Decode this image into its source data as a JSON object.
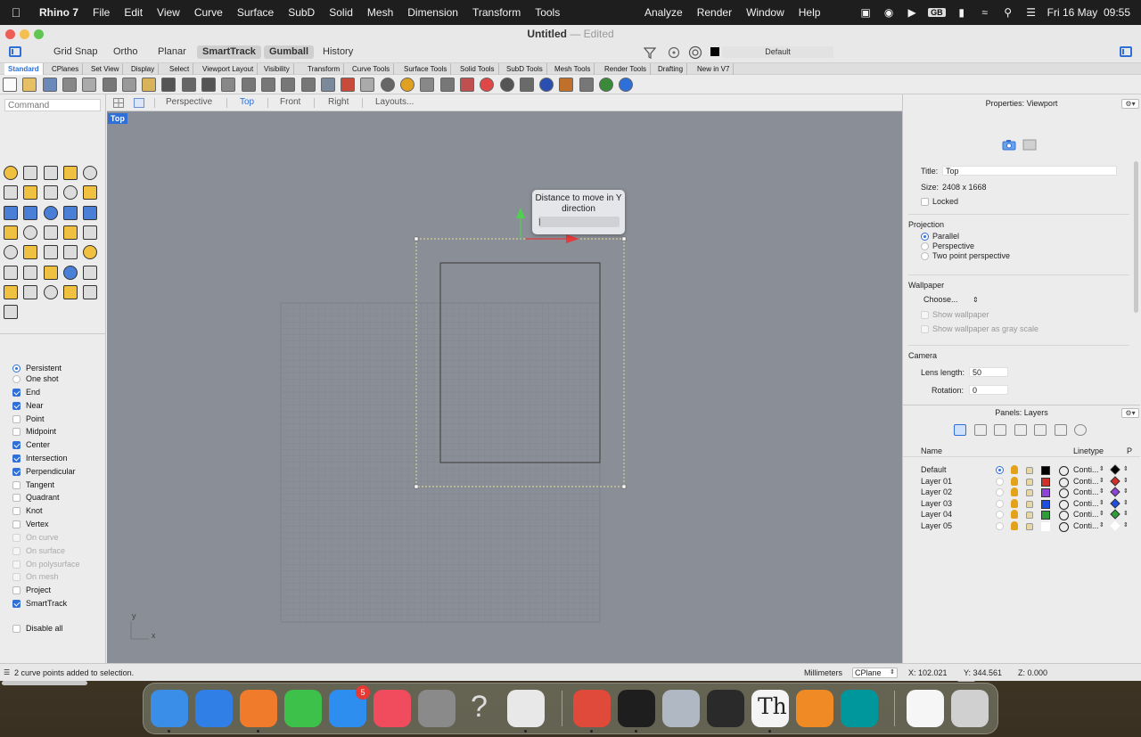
{
  "menubar": {
    "app_name": "Rhino 7",
    "menus": [
      "File",
      "Edit",
      "View",
      "Curve",
      "Surface",
      "SubD",
      "Solid",
      "Mesh",
      "Dimension",
      "Transform",
      "Tools"
    ],
    "menus_right": [
      "Analyze",
      "Render",
      "Window",
      "Help"
    ],
    "input_source": "GB",
    "clock": "Fri 16 May  09:55"
  },
  "window": {
    "title": "Untitled",
    "subtitle": "— Edited"
  },
  "toggles": {
    "items": [
      "Grid Snap",
      "Ortho",
      "Planar",
      "SmartTrack",
      "Gumball",
      "History"
    ],
    "layer_label": "Default"
  },
  "tabs": [
    "Standard",
    "CPlanes",
    "Set View",
    "Display",
    "Select",
    "Viewport Layout",
    "Visibility",
    "Transform",
    "Curve Tools",
    "Surface Tools",
    "Solid Tools",
    "SubD Tools",
    "Mesh Tools",
    "Render Tools",
    "Drafting",
    "New in V7"
  ],
  "command": {
    "placeholder": "Command"
  },
  "osnaps": [
    {
      "label": "Persistent",
      "kind": "radio",
      "on": true
    },
    {
      "label": "One shot",
      "kind": "radio",
      "on": false
    },
    {
      "label": "End",
      "kind": "check",
      "on": true
    },
    {
      "label": "Near",
      "kind": "check",
      "on": true
    },
    {
      "label": "Point",
      "kind": "check",
      "on": false
    },
    {
      "label": "Midpoint",
      "kind": "check",
      "on": false
    },
    {
      "label": "Center",
      "kind": "check",
      "on": true
    },
    {
      "label": "Intersection",
      "kind": "check",
      "on": true
    },
    {
      "label": "Perpendicular",
      "kind": "check",
      "on": true
    },
    {
      "label": "Tangent",
      "kind": "check",
      "on": false
    },
    {
      "label": "Quadrant",
      "kind": "check",
      "on": false
    },
    {
      "label": "Knot",
      "kind": "check",
      "on": false
    },
    {
      "label": "Vertex",
      "kind": "check",
      "on": false
    },
    {
      "label": "On curve",
      "kind": "check",
      "on": false,
      "disabled": true
    },
    {
      "label": "On surface",
      "kind": "check",
      "on": false,
      "disabled": true
    },
    {
      "label": "On polysurface",
      "kind": "check",
      "on": false,
      "disabled": true
    },
    {
      "label": "On mesh",
      "kind": "check",
      "on": false,
      "disabled": true
    },
    {
      "label": "Project",
      "kind": "check",
      "on": false
    },
    {
      "label": "SmartTrack",
      "kind": "check",
      "on": true
    },
    {
      "label": "Disable all",
      "kind": "check",
      "on": false
    }
  ],
  "viewport_tabs": [
    "Perspective",
    "Top",
    "Front",
    "Right",
    "Layouts..."
  ],
  "viewport": {
    "label": "Top",
    "tooltip": "Distance to move in Y direction",
    "axis_x": "x",
    "axis_y": "y"
  },
  "properties": {
    "header": "Properties: Viewport",
    "title_label": "Title:",
    "title_value": "Top",
    "size_label": "Size:",
    "size_value": "2408 x 1668",
    "locked_label": "Locked",
    "projection_title": "Projection",
    "projection_options": [
      "Parallel",
      "Perspective",
      "Two point perspective"
    ],
    "projection_selected": "Parallel",
    "wallpaper_title": "Wallpaper",
    "wallpaper_choose": "Choose...",
    "wallpaper_show": "Show wallpaper",
    "wallpaper_gray": "Show wallpaper as gray scale",
    "camera_title": "Camera",
    "lens_label": "Lens length:",
    "lens_value": "50",
    "rotation_label": "Rotation:",
    "rotation_value": "0"
  },
  "layers": {
    "header": "Panels: Layers",
    "col_name": "Name",
    "col_linetype": "Linetype",
    "col_extra": "P",
    "rows": [
      {
        "name": "Default",
        "color": "#000000",
        "linetype": "Conti...",
        "current": true
      },
      {
        "name": "Layer 01",
        "color": "#d0302a",
        "linetype": "Conti...",
        "current": false
      },
      {
        "name": "Layer 02",
        "color": "#8e44d6",
        "linetype": "Conti...",
        "current": false
      },
      {
        "name": "Layer 03",
        "color": "#1f4fe0",
        "linetype": "Conti...",
        "current": false
      },
      {
        "name": "Layer 04",
        "color": "#2e9e3a",
        "linetype": "Conti...",
        "current": false
      },
      {
        "name": "Layer 05",
        "color": "#ffffff",
        "linetype": "Conti...",
        "current": false
      }
    ]
  },
  "status": {
    "message": "2 curve points added to selection.",
    "units": "Millimeters",
    "cplane": "CPlane",
    "x": "X: 102.021",
    "y": "Y: 344.561",
    "z": "Z: 0.000"
  },
  "dock": {
    "apps": [
      "finder-icon",
      "safari-icon",
      "firefox-icon",
      "messages-icon",
      "mail-icon",
      "music-icon",
      "system-settings-icon",
      "help-icon",
      "rhino-icon",
      "chrome-icon",
      "terminal-icon",
      "preview-icon",
      "zed-icon",
      "th-icon",
      "blender-icon",
      "arduino-icon",
      "documents-icon",
      "trash-icon"
    ],
    "mail_badge": "5",
    "th_label": "Th"
  },
  "colors": {
    "accent": "#2f6fd8",
    "viewport_bg": "#8a8e96"
  }
}
